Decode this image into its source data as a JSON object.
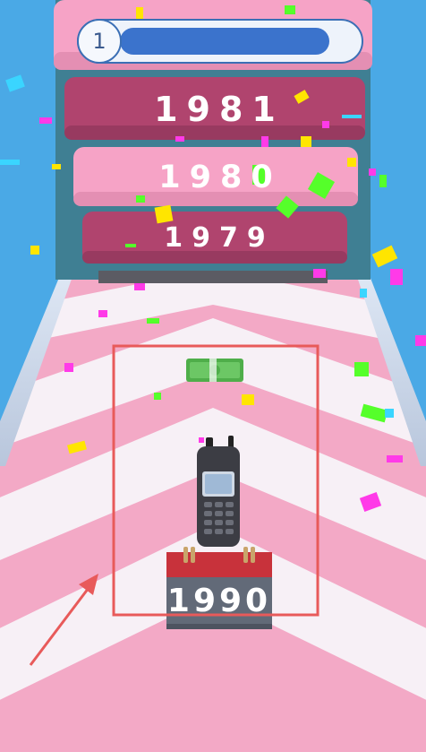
{
  "hud": {
    "level_number": "1",
    "level_progress": 0.92
  },
  "tower": {
    "blocks": [
      {
        "year": "1981",
        "style": "dark"
      },
      {
        "year": "1980",
        "style": "light"
      },
      {
        "year": "1979",
        "style": "dark"
      }
    ]
  },
  "player": {
    "item": "mobile-phone",
    "calendar_year": "1990"
  },
  "pickup": {
    "item": "cash-bundle"
  },
  "overlay": {
    "highlight_color": "#e85a5a",
    "arrow_color": "#e85a5a"
  },
  "colors": {
    "sky": "#4aa9e6",
    "track_pink": "#f3a9c6",
    "track_white": "#f7f0f6",
    "tower_frame": "#3f7f93",
    "block_dark": "#b0446e",
    "block_light": "#f6a3c6"
  }
}
